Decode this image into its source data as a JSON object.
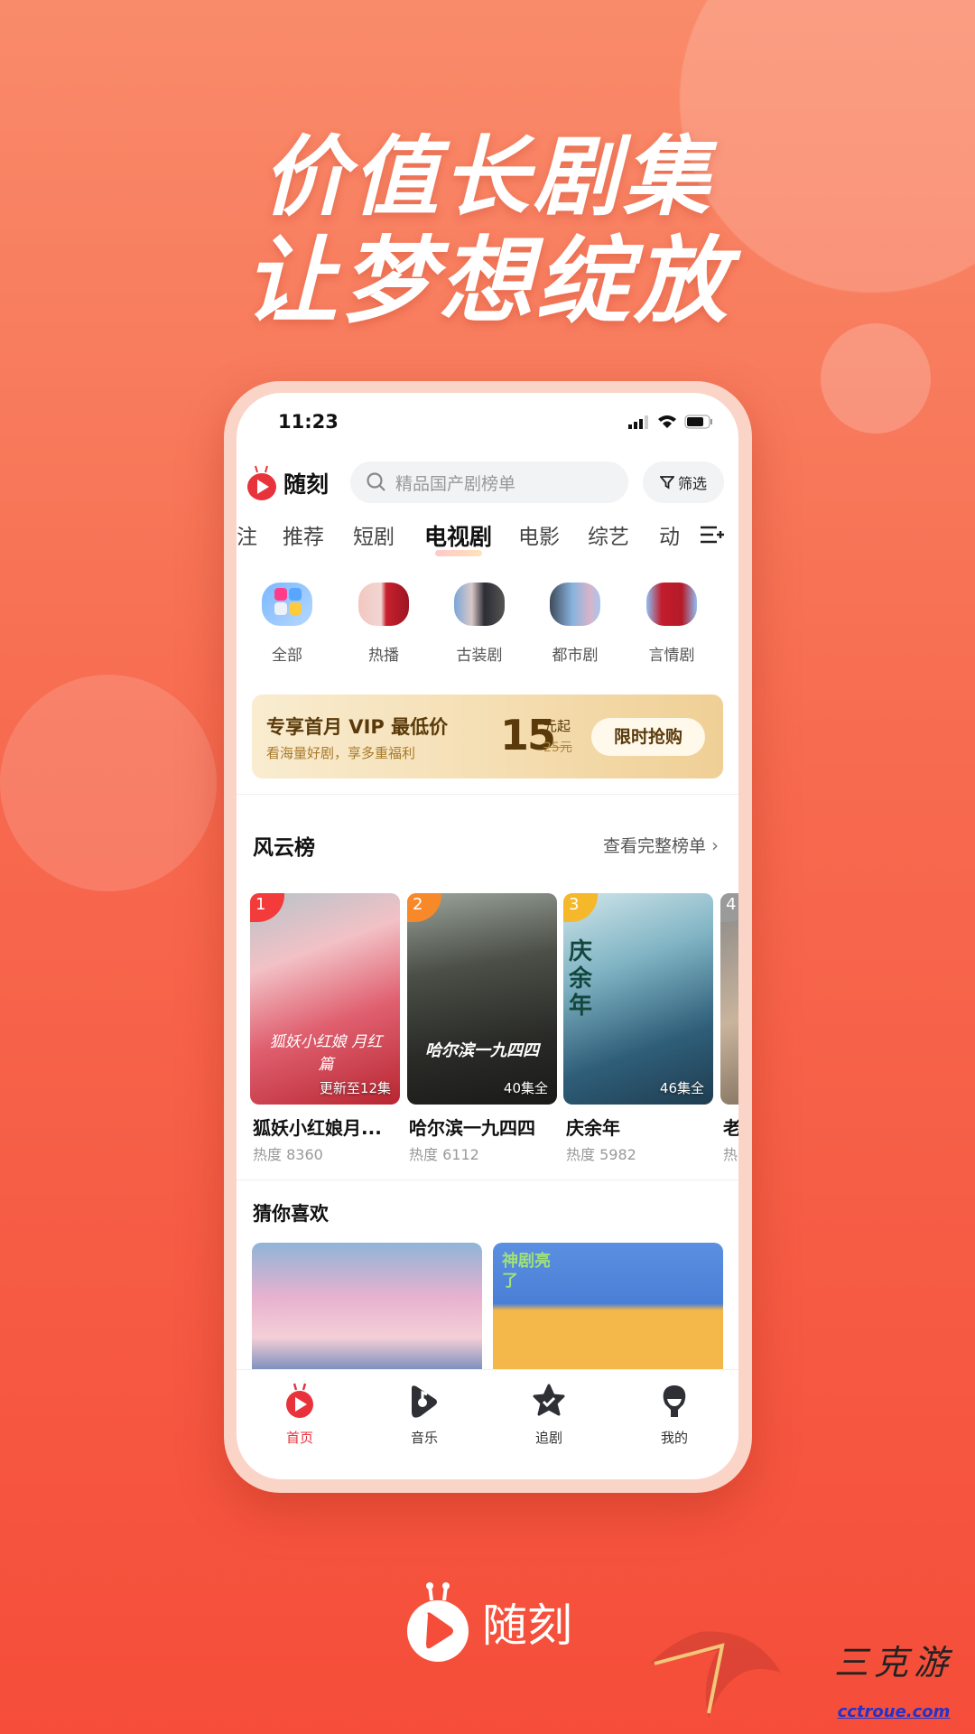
{
  "promo": {
    "headline_1": "价值长剧集",
    "headline_2": "让梦想绽放",
    "brand": "随刻"
  },
  "status_bar": {
    "time": "11:23"
  },
  "header": {
    "app_name": "随刻",
    "search_placeholder": "精品国产剧榜单",
    "filter_label": "筛选"
  },
  "tabs": [
    {
      "label": "注"
    },
    {
      "label": "推荐"
    },
    {
      "label": "短剧"
    },
    {
      "label": "电视剧",
      "active": true
    },
    {
      "label": "电影"
    },
    {
      "label": "综艺"
    },
    {
      "label": "动"
    }
  ],
  "categories": [
    {
      "label": "全部"
    },
    {
      "label": "热播"
    },
    {
      "label": "古装剧"
    },
    {
      "label": "都市剧"
    },
    {
      "label": "言情剧"
    }
  ],
  "vip_banner": {
    "title": "专享首月 VIP 最低价",
    "subtitle": "看海量好剧，享多重福利",
    "price": "15",
    "price_unit": "元起",
    "original_price": "25元",
    "cta": "限时抢购"
  },
  "ranking": {
    "title": "风云榜",
    "more_label": "查看完整榜单",
    "items": [
      {
        "rank": "1",
        "title": "狐妖小红娘月...",
        "heat": "热度 8360",
        "episodes": "更新至12集",
        "poster_title": "狐妖小红娘 月红篇"
      },
      {
        "rank": "2",
        "title": "哈尔滨一九四四",
        "heat": "热度 6112",
        "episodes": "40集全",
        "poster_title": "哈尔滨一九四四"
      },
      {
        "rank": "3",
        "title": "庆余年",
        "heat": "热度 5982",
        "episodes": "46集全",
        "poster_title": "庆余年"
      },
      {
        "rank": "4",
        "title": "老",
        "heat": "热",
        "episodes": ""
      }
    ]
  },
  "recommend": {
    "title": "猜你喜欢",
    "items": [
      {
        "poster_title": ""
      },
      {
        "poster_title": "神剧亮了"
      }
    ]
  },
  "bottom_nav": [
    {
      "label": "首页",
      "icon": "home-play-icon",
      "active": true
    },
    {
      "label": "音乐",
      "icon": "music-icon"
    },
    {
      "label": "追剧",
      "icon": "star-check-icon"
    },
    {
      "label": "我的",
      "icon": "profile-icon"
    }
  ],
  "watermark": {
    "text": "三克游",
    "url": "cctroue.com"
  },
  "colors": {
    "accent": "#e8323c",
    "bg_top": "#f98b6a",
    "bg_bottom": "#f54d39",
    "vip_gold": "#6b4a10"
  }
}
